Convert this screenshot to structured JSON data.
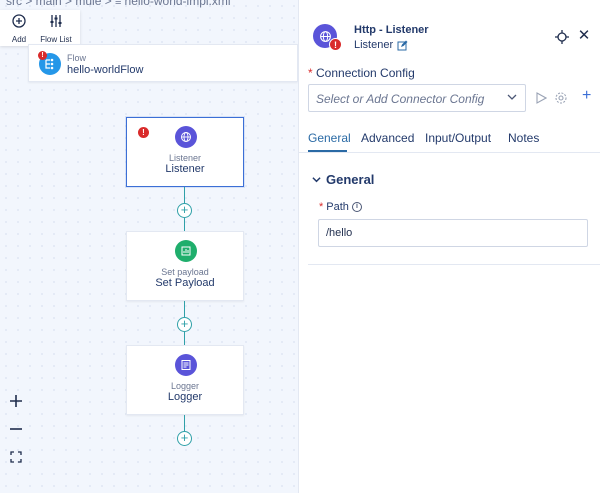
{
  "breadcrumb": {
    "text": "src  >  main  >  mule  >  ",
    "file_name": "hello-world-impl.xml",
    "file_icon": "file-icon"
  },
  "toolbar": {
    "add_label": "Add",
    "flow_list_label": "Flow List"
  },
  "flow": {
    "type_label": "Flow",
    "name": "hello-worldFlow",
    "error_mark": "!"
  },
  "nodes": [
    {
      "type": "Listener",
      "name": "Listener",
      "icon": "globe-icon",
      "color": "#5a54d9",
      "selected": true,
      "error_mark": "!"
    },
    {
      "type": "Set payload",
      "name": "Set Payload",
      "icon": "payload-icon",
      "color": "#1fae6c"
    },
    {
      "type": "Logger",
      "name": "Logger",
      "icon": "logger-icon",
      "color": "#5a54d9"
    }
  ],
  "panel": {
    "title": "Http - Listener",
    "subtitle": "Listener",
    "error_mark": "!",
    "connection_config": {
      "required_mark": "*",
      "label": "Connection Config",
      "placeholder": "Select or Add Connector Config",
      "add_symbol": "+"
    },
    "tabs": [
      {
        "label": "General",
        "active": true
      },
      {
        "label": "Advanced"
      },
      {
        "label": "Input/Output"
      },
      {
        "label": "Notes"
      }
    ],
    "section": {
      "title": "General",
      "path": {
        "required_mark": "*",
        "label": "Path",
        "info_glyph": "i",
        "value": "/hello"
      }
    }
  },
  "zoom": {
    "in_symbol": "+",
    "out_symbol": "−"
  },
  "add_node_symbol": "+",
  "colors": {
    "accent": "#2a6aa5",
    "error": "#d92b2b",
    "connector": "#2fa0a8",
    "flow_blue": "#2597e8"
  }
}
